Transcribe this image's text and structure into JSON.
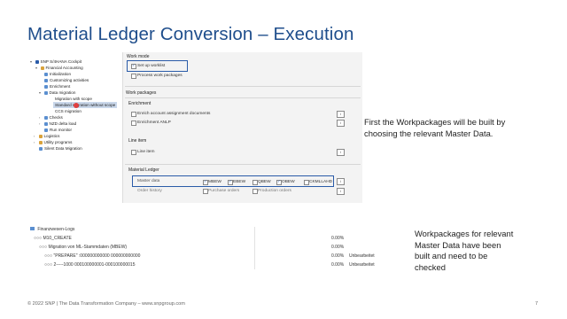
{
  "slide": {
    "title": "Material Ledger Conversion – Execution",
    "footer": "© 2022 SNP | The Data Transformation Company – www.snpgroup.com",
    "page_number": "7"
  },
  "tree": {
    "items": [
      {
        "label": "SNP S/4HANA Cockpit"
      },
      {
        "label": "Financial Accounting"
      },
      {
        "label": "Initialization"
      },
      {
        "label": "Customizing activities"
      },
      {
        "label": "Enrichment"
      },
      {
        "label": "Data migration"
      },
      {
        "label": "Migration with scope"
      },
      {
        "label": "Standard migration without scope"
      },
      {
        "label": "CCS migration"
      },
      {
        "label": "Checks"
      },
      {
        "label": "NZD delta load"
      },
      {
        "label": "Run monitor"
      },
      {
        "label": "Logistics"
      },
      {
        "label": "Utility programs"
      },
      {
        "label": "Silent Data Migration"
      }
    ]
  },
  "work_mode": {
    "heading": "Work mode",
    "setup_worklist": "Set up worklist",
    "process_packages": "Process work packages"
  },
  "work_packages": {
    "heading": "Work packages",
    "enrichment_heading": "Enrichment",
    "enrich_account": "Enrich account assignment documents",
    "enrichment_anlp": "Enrichment ANLP",
    "line_item_heading": "Line item",
    "line_item": "Line item"
  },
  "material_ledger": {
    "heading": "Material Ledger",
    "master_data_label": "Master data",
    "order_history_label": "Order history",
    "master_options": [
      {
        "label": "MBEW",
        "checked": true
      },
      {
        "label": "EBEW",
        "checked": true
      },
      {
        "label": "QBEW",
        "checked": false
      },
      {
        "label": "OBEW",
        "checked": true
      },
      {
        "label": "CKMLLAHD",
        "checked": false
      }
    ],
    "order_options": [
      {
        "label": "Purchase orders",
        "checked": false
      },
      {
        "label": "Production orders",
        "checked": false
      }
    ],
    "info_icon": "i"
  },
  "notes": {
    "note1_line1": "First the Workpackages will be built by",
    "note1_line2": "choosing the relevant Master Data.",
    "note2_line1": "Workpackages for relevant",
    "note2_line2": "Master Data have been",
    "note2_line3": "built and need to be",
    "note2_line4": "checked"
  },
  "log": {
    "rows": [
      {
        "label": "Finanzwesen-Logs",
        "pct": "",
        "status": ""
      },
      {
        "label": "○○○  M10_CREATE",
        "pct": "0.00%",
        "status": ""
      },
      {
        "label": "○○○  Migration von ML-Stammdaten (MBEW)",
        "pct": "0.00%",
        "status": ""
      },
      {
        "label": "○○○  \"PREPARE\" :000000000000 000000000000",
        "pct": "0.00%",
        "status": "Unbearbeitet"
      },
      {
        "label": "○○○  2-----1000 000100000001-000100000015",
        "pct": "0.00%",
        "status": "Unbearbeitet"
      }
    ]
  },
  "colors": {
    "title": "#1f4e8c",
    "highlight": "#2a5ba8",
    "selection": "#c9d7ea"
  }
}
